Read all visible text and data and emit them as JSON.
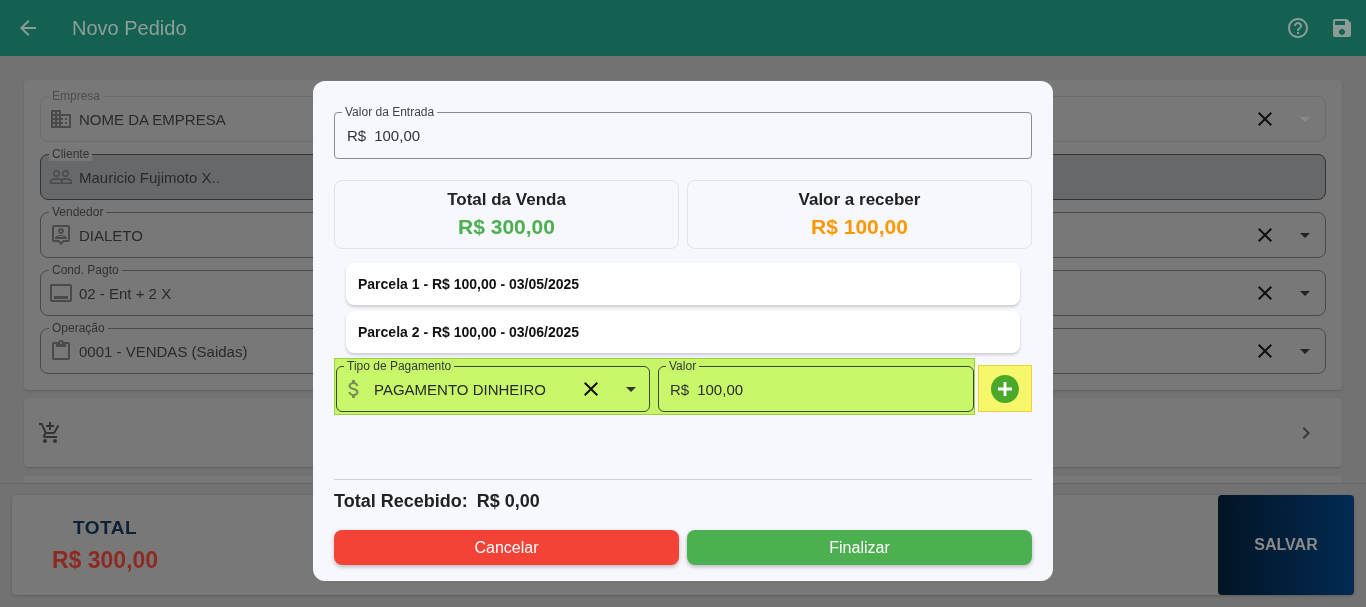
{
  "app_bar": {
    "title": "Novo Pedido"
  },
  "form": {
    "fields": [
      {
        "label": "Empresa",
        "value": "NOME DA EMPRESA",
        "kind": "select",
        "disabled": true
      },
      {
        "label": "Cliente",
        "value": "Mauricio Fujimoto X..",
        "kind": "text",
        "disabled": false
      },
      {
        "label": "Vendedor",
        "value": "DIALETO",
        "kind": "select",
        "disabled": false
      },
      {
        "label": "Cond. Pagto",
        "value": "02 - Ent + 2 X",
        "kind": "select",
        "disabled": false
      },
      {
        "label": "Operação",
        "value": "0001 - VENDAS (Saidas)",
        "kind": "select",
        "disabled": false
      }
    ]
  },
  "bottom_bar": {
    "total_label": "TOTAL",
    "total_value": "R$ 300,00",
    "save_button": "SALVAR"
  },
  "modal": {
    "entry_field": {
      "label": "Valor da Entrada",
      "prefix": "R$",
      "value": "100,00"
    },
    "summary": [
      {
        "title": "Total da Venda",
        "value": "R$ 300,00",
        "color": "#4caf50"
      },
      {
        "title": "Valor a receber",
        "value": "R$ 100,00",
        "color": "#ff9800"
      }
    ],
    "installments": [
      "Parcela 1 - R$ 100,00 - 03/05/2025",
      "Parcela 2 - R$ 100,00 - 03/06/2025"
    ],
    "payment": {
      "highlighted": true,
      "type_field": {
        "label": "Tipo de Pagamento",
        "value": "PAGAMENTO DINHEIRO"
      },
      "value_field": {
        "label": "Valor",
        "prefix": "R$",
        "value": "100,00"
      },
      "add_button": {
        "highlighted": true
      }
    },
    "total_received": {
      "label": "Total Recebido:",
      "value": "R$ 0,00"
    },
    "buttons": [
      {
        "label": "Cancelar",
        "kind": "cancel"
      },
      {
        "label": "Finalizar",
        "kind": "confirm"
      }
    ]
  }
}
